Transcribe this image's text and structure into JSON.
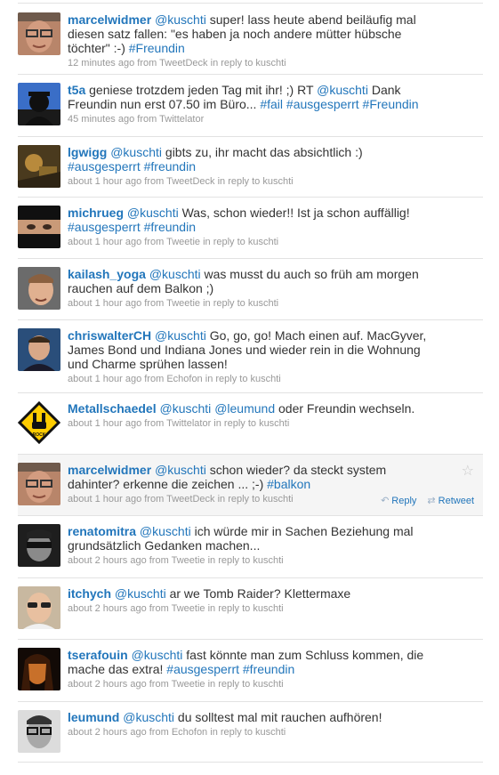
{
  "tweets": [
    {
      "user": "marcelwidmer",
      "segments": [
        {
          "t": "mention",
          "v": "@kuschti"
        },
        {
          "t": "text",
          "v": " super! lass heute abend beiläufig mal diesen satz fallen: \"es haben ja noch andere mütter hübsche töchter\" :-) "
        },
        {
          "t": "tag",
          "v": "#Freundin"
        }
      ],
      "time": "12 minutes ago",
      "source": "TweetDeck",
      "reply_to": "kuschti",
      "avatar_icon": "avatar-man-glasses-icon"
    },
    {
      "user": "t5a",
      "segments": [
        {
          "t": "text",
          "v": " geniese trotzdem jeden Tag mit ihr! ;) RT "
        },
        {
          "t": "mention",
          "v": "@kuschti"
        },
        {
          "t": "text",
          "v": " Dank Freundin nun erst 07.50 im Büro... "
        },
        {
          "t": "tag",
          "v": "#fail"
        },
        {
          "t": "text",
          "v": " "
        },
        {
          "t": "tag",
          "v": "#ausgesperrt"
        },
        {
          "t": "text",
          "v": " "
        },
        {
          "t": "tag",
          "v": "#Freundin"
        }
      ],
      "time": "45 minutes ago",
      "source": "Twittelator",
      "reply_to": "",
      "avatar_icon": "avatar-silhouette-icon"
    },
    {
      "user": "lgwigg",
      "segments": [
        {
          "t": "mention",
          "v": "@kuschti"
        },
        {
          "t": "text",
          "v": " gibts zu, ihr macht das absichtlich :) "
        },
        {
          "t": "tag",
          "v": "#ausgesperrt"
        },
        {
          "t": "text",
          "v": " "
        },
        {
          "t": "tag",
          "v": "#freundin"
        }
      ],
      "time": "about 1 hour ago",
      "source": "TweetDeck",
      "reply_to": "kuschti",
      "avatar_icon": "avatar-brown-photo-icon"
    },
    {
      "user": "michrueg",
      "segments": [
        {
          "t": "mention",
          "v": "@kuschti"
        },
        {
          "t": "text",
          "v": " Was, schon wieder!! Ist ja schon auffällig! "
        },
        {
          "t": "tag",
          "v": "#ausgesperrt"
        },
        {
          "t": "text",
          "v": " "
        },
        {
          "t": "tag",
          "v": "#freundin"
        }
      ],
      "time": "about 1 hour ago",
      "source": "Tweetie",
      "reply_to": "kuschti",
      "avatar_icon": "avatar-eyes-icon"
    },
    {
      "user": "kailash_yoga",
      "segments": [
        {
          "t": "mention",
          "v": "@kuschti"
        },
        {
          "t": "text",
          "v": " was musst du auch so früh am morgen rauchen auf dem Balkon ;)"
        }
      ],
      "time": "about 1 hour ago",
      "source": "Tweetie",
      "reply_to": "kuschti",
      "avatar_icon": "avatar-man-face-icon"
    },
    {
      "user": "chriswalterCH",
      "segments": [
        {
          "t": "mention",
          "v": "@kuschti"
        },
        {
          "t": "text",
          "v": " Go, go, go! Mach einen auf. MacGyver, James Bond und Indiana Jones und wieder rein in die Wohnung und Charme sprühen lassen!"
        }
      ],
      "time": "about 1 hour ago",
      "source": "Echofon",
      "reply_to": "kuschti",
      "avatar_icon": "avatar-man-smiling-icon"
    },
    {
      "user": "Metallschaedel",
      "segments": [
        {
          "t": "mention",
          "v": "@kuschti"
        },
        {
          "t": "text",
          "v": " "
        },
        {
          "t": "mention",
          "v": "@leumund"
        },
        {
          "t": "text",
          "v": " oder Freundin wechseln."
        }
      ],
      "time": "about 1 hour ago",
      "source": "Twittelator",
      "reply_to": "kuschti",
      "avatar_icon": "avatar-rock-sign-icon",
      "avatar_text": "ROCK"
    },
    {
      "user": "marcelwidmer",
      "segments": [
        {
          "t": "mention",
          "v": "@kuschti"
        },
        {
          "t": "text",
          "v": " schon wieder? da steckt system dahinter? erkenne die zeichen ... ;-) "
        },
        {
          "t": "tag",
          "v": "#balkon"
        }
      ],
      "time": "about 1 hour ago",
      "source": "TweetDeck",
      "reply_to": "kuschti",
      "avatar_icon": "avatar-man-glasses-icon",
      "hover": true
    },
    {
      "user": "renatomitra",
      "segments": [
        {
          "t": "mention",
          "v": "@kuschti"
        },
        {
          "t": "text",
          "v": " ich würde mir in Sachen Beziehung mal grundsätzlich Gedanken machen..."
        }
      ],
      "time": "about 2 hours ago",
      "source": "Tweetie",
      "reply_to": "kuschti",
      "avatar_icon": "avatar-bw-sunglasses-icon"
    },
    {
      "user": "itchych",
      "segments": [
        {
          "t": "mention",
          "v": "@kuschti"
        },
        {
          "t": "text",
          "v": " ar we Tomb Raider? Klettermaxe"
        }
      ],
      "time": "about 2 hours ago",
      "source": "Tweetie",
      "reply_to": "kuschti",
      "avatar_icon": "avatar-man-sunglasses-icon"
    },
    {
      "user": "tserafouin",
      "segments": [
        {
          "t": "mention",
          "v": "@kuschti"
        },
        {
          "t": "text",
          "v": " fast könnte man zum Schluss kommen, die mache das extra! "
        },
        {
          "t": "tag",
          "v": "#ausgesperrt"
        },
        {
          "t": "text",
          "v": " "
        },
        {
          "t": "tag",
          "v": "#freundin"
        }
      ],
      "time": "about 2 hours ago",
      "source": "Tweetie",
      "reply_to": "kuschti",
      "avatar_icon": "avatar-woman-dark-icon"
    },
    {
      "user": "leumund",
      "segments": [
        {
          "t": "mention",
          "v": "@kuschti"
        },
        {
          "t": "text",
          "v": " du solltest mal mit rauchen aufhören!"
        }
      ],
      "time": "about 2 hours ago",
      "source": "Echofon",
      "reply_to": "kuschti",
      "avatar_icon": "avatar-man-bw-glasses-icon"
    }
  ],
  "labels": {
    "from": "from",
    "in_reply_to": "in reply to",
    "reply": "Reply",
    "retweet": "Retweet"
  },
  "colors": {
    "link": "#2276bb",
    "text": "#333333",
    "meta": "#999999",
    "divider": "#e2e2e2",
    "hover_bg": "#f5f5f5"
  }
}
